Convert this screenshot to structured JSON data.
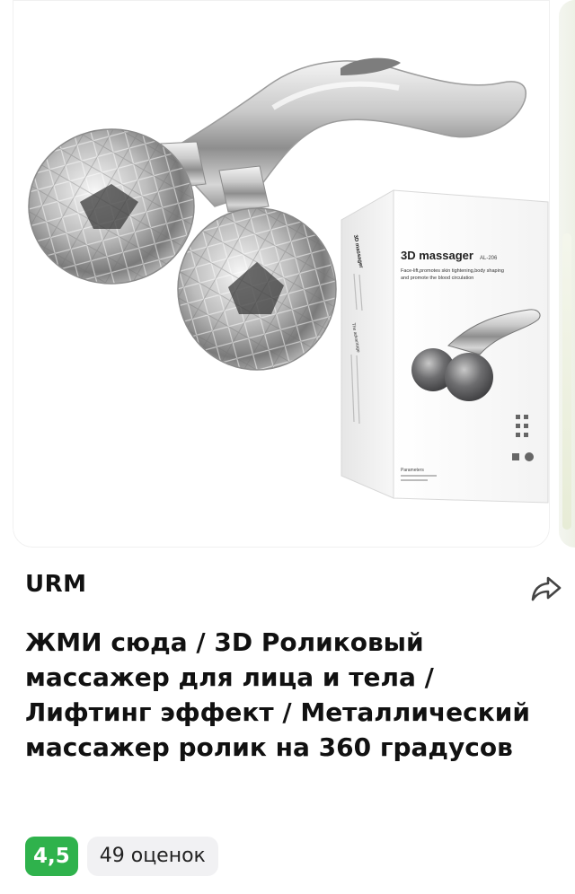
{
  "product": {
    "brand": "URM",
    "title": "ЖМИ сюда / 3D Роликовый массажер для лица и тела / Лифтинг эффект / Металлический массажер ролик на 360 градусов",
    "rating": "4,5",
    "reviews": "49 оценок"
  },
  "box": {
    "title": "3D massager",
    "model": "AL-206",
    "side_title": "3D massager",
    "tagline_1": "Face-lift,promotes skin tightening,body shaping",
    "tagline_2": "and promote the blood circulation",
    "side_section": "The advantage",
    "params_label": "Parameters"
  },
  "icons": {
    "share": "share-arrow-icon"
  },
  "colors": {
    "rating_green": "#2fb24c",
    "chip_bg": "#f1f1f3"
  }
}
